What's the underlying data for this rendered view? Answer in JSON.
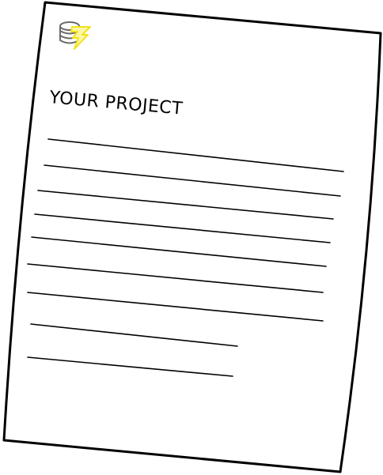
{
  "document": {
    "title": "YOUR PROJECT",
    "logo_icon": "database-lightning-icon",
    "line_count": 9
  },
  "colors": {
    "paper": "#ffffff",
    "outline": "#000000",
    "logo_stack": "#6b6b6b",
    "logo_bolt": "#f2e21b"
  }
}
